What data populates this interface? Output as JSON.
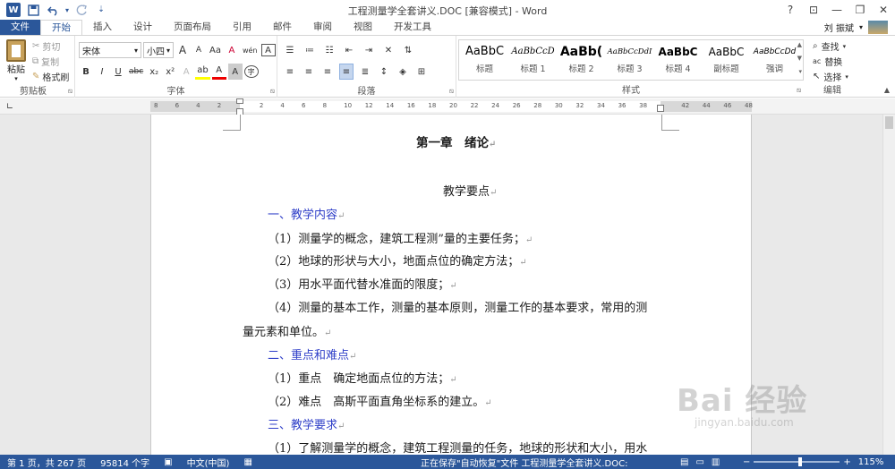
{
  "titlebar": {
    "word_logo": "W",
    "title": "工程测量学全套讲义.DOC [兼容模式] - Word",
    "icons": [
      "save-icon",
      "undo-icon",
      "redo-icon",
      "customize-qat-icon"
    ]
  },
  "window": {
    "help": "?",
    "minimize": "—",
    "restore": "❐",
    "close": "✕",
    "ribbon_display": "⊡"
  },
  "tabs": [
    "文件",
    "开始",
    "插入",
    "设计",
    "页面布局",
    "引用",
    "邮件",
    "审阅",
    "视图",
    "开发工具"
  ],
  "active_tab": "开始",
  "user": {
    "name": "刘 振斌"
  },
  "clipboard": {
    "paste": "粘贴",
    "cut": "剪切",
    "copy": "复制",
    "format_painter": "格式刷",
    "label": "剪贴板"
  },
  "font": {
    "name": "宋体",
    "size": "小四",
    "label": "字体",
    "grow": "A",
    "shrink": "A",
    "case": "Aa",
    "clear": "A",
    "phonetic": "wén",
    "border": "A",
    "bold": "B",
    "italic": "I",
    "underline": "U",
    "strike": "abc",
    "sub": "x₂",
    "sup": "x²",
    "effects": "A",
    "highlight": "ab",
    "color": "A",
    "shade": "A",
    "enclose": "字"
  },
  "paragraph": {
    "label": "段落"
  },
  "styles": {
    "label": "样式",
    "items": [
      {
        "sample": "AaBbC",
        "name": "标题"
      },
      {
        "sample": "AaBbCcD",
        "name": "标题 1"
      },
      {
        "sample": "AaBb(",
        "name": "标题 2"
      },
      {
        "sample": "AaBbCcDdI",
        "name": "标题 3"
      },
      {
        "sample": "AaBbC",
        "name": "标题 4"
      },
      {
        "sample": "AaBbC",
        "name": "副标题"
      },
      {
        "sample": "AaBbCcDd",
        "name": "强调"
      }
    ]
  },
  "editing": {
    "find": "查找",
    "replace": "替换",
    "select": "选择",
    "label": "编辑"
  },
  "ruler": {
    "ticks": [
      "8",
      "6",
      "4",
      "2",
      "",
      "2",
      "4",
      "6",
      "8",
      "10",
      "12",
      "14",
      "16",
      "18",
      "20",
      "22",
      "24",
      "26",
      "28",
      "30",
      "32",
      "34",
      "36",
      "38",
      "",
      "42",
      "44",
      "46",
      "48"
    ]
  },
  "document": {
    "chapter": "第一章　绪论",
    "subtitle": "教学要点",
    "h1": "一、教学内容",
    "p1": "（1）测量学的概念，建筑工程测”量的主要任务；",
    "p2": "（2）地球的形状与大小，地面点位的确定方法；",
    "p3": "（3）用水平面代替水准面的限度；",
    "p4a": "（4）测量的基本工作，测量的基本原则，测量工作的基本要求，常用的测",
    "p4b": "量元素和单位。",
    "h2": "二、重点和难点",
    "p5": "（1）重点　确定地面点位的方法；",
    "p6": "（2）难点　高斯平面直角坐标系的建立。",
    "h3": "三、教学要求",
    "p7": "（1）了解测量学的概念，建筑工程测量的任务，地球的形状和大小，用水",
    "para_mark": "↵"
  },
  "watermark": {
    "main": "Bai 经验",
    "sub": "jingyan.baidu.com"
  },
  "status": {
    "page": "第 1 页，共 267 页",
    "words": "95814 个字",
    "lang": "中文(中国)",
    "saving": "正在保存\"自动恢复\"文件 工程测量学全套讲义.DOC:",
    "zoom": "115%"
  }
}
